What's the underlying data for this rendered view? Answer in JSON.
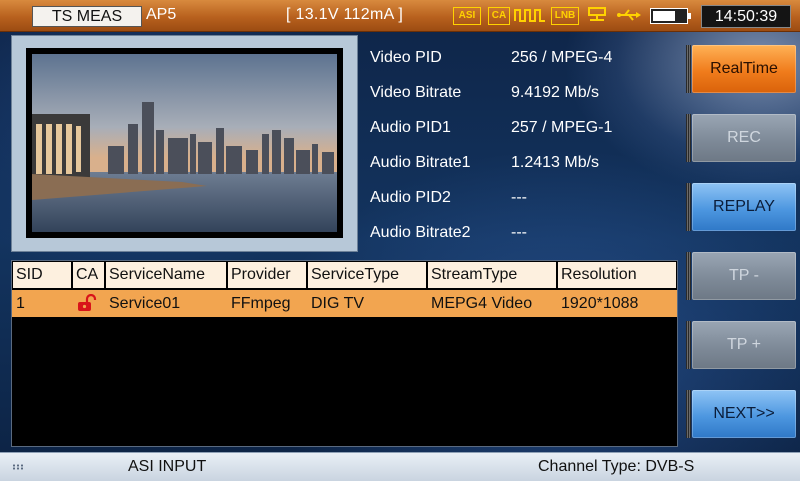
{
  "status_bar": {
    "mode": "TS MEAS",
    "ap": "AP5",
    "power": "[ 13.1V 112mA ]",
    "icons": [
      "asi-icon",
      "ca-icon",
      "signal-wave-icon",
      "lnb-icon",
      "network-icon",
      "usb-icon",
      "battery-icon"
    ],
    "icon_labels": {
      "asi": "ASI",
      "ca": "CA",
      "lnb": "LNB"
    },
    "time": "14:50:39",
    "accent": "#c06a24"
  },
  "video_info": [
    {
      "label": "Video PID",
      "value": "256 / MPEG-4"
    },
    {
      "label": "Video Bitrate",
      "value": "9.4192 Mb/s"
    },
    {
      "label": "Audio PID1",
      "value": "257 / MPEG-1"
    },
    {
      "label": "Audio Bitrate1",
      "value": "1.2413 Mb/s"
    },
    {
      "label": "Audio PID2",
      "value": "---"
    },
    {
      "label": "Audio Bitrate2",
      "value": "---"
    }
  ],
  "side_buttons": [
    {
      "label": "RealTime",
      "state": "active"
    },
    {
      "label": "REC",
      "state": "disabled"
    },
    {
      "label": "REPLAY",
      "state": "enabled"
    },
    {
      "label": "TP -",
      "state": "disabled"
    },
    {
      "label": "TP +",
      "state": "disabled"
    },
    {
      "label": "NEXT>>",
      "state": "enabled"
    }
  ],
  "services_table": {
    "columns": [
      "SID",
      "CA",
      "ServiceName",
      "Provider",
      "ServiceType",
      "StreamType",
      "Resolution"
    ],
    "rows": [
      {
        "sid": "1",
        "ca": "lock-icon",
        "service_name": "Service01",
        "provider": "FFmpeg",
        "service_type": "DIG TV",
        "stream_type": "MEPG4 Video",
        "resolution": "1920*1088"
      }
    ],
    "selected_row_color": "#f2a550"
  },
  "bottom_bar": {
    "input": "ASI INPUT",
    "channel_type": "Channel Type: DVB-S"
  }
}
